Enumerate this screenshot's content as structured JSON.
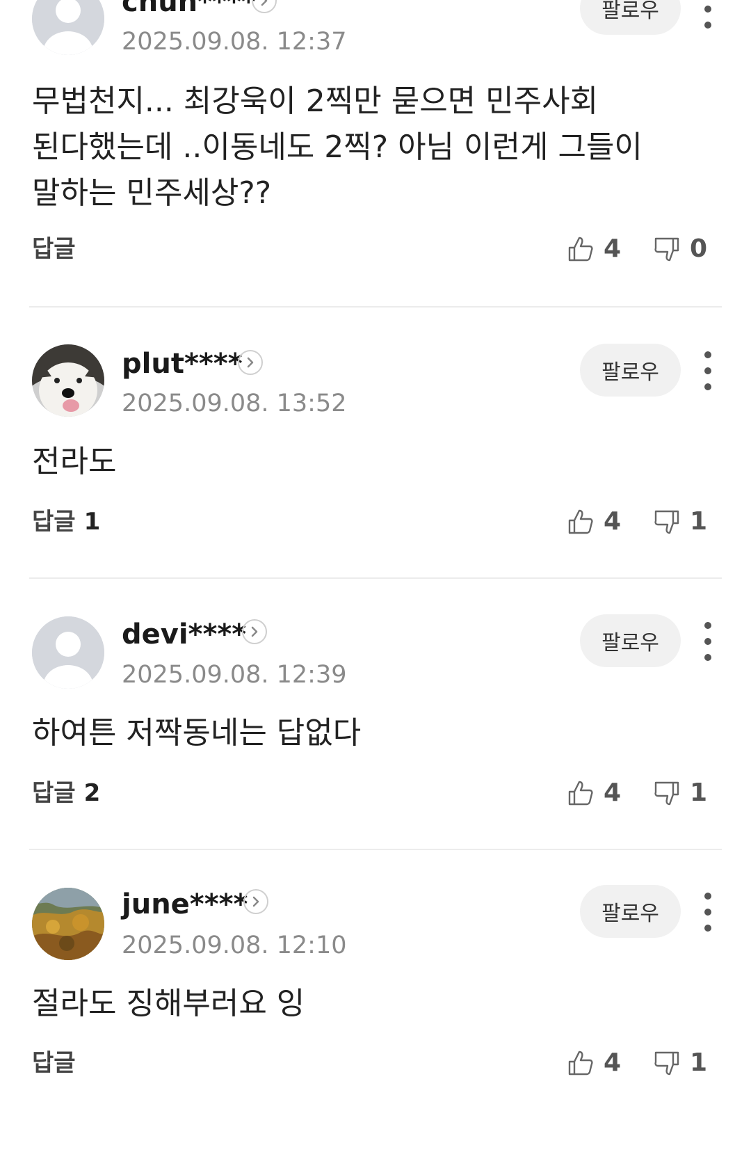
{
  "labels": {
    "follow": "팔로우",
    "reply": "답글"
  },
  "comments": [
    {
      "user": "chun****",
      "time": "2025.09.08. 12:37",
      "avatar": "default-avatar",
      "text": "무법천지... 최강욱이 2찍만 묻으면 민주사회 된다했는데 ..이동네도 2찍? 아님 이런게 그들이 말하는 민주세상??",
      "reply_count": "",
      "likes": "4",
      "dislikes": "0"
    },
    {
      "user": "plut****",
      "time": "2025.09.08. 13:52",
      "avatar": "husky-dog-photo",
      "text": "전라도",
      "reply_count": "1",
      "likes": "4",
      "dislikes": "1"
    },
    {
      "user": "devi****",
      "time": "2025.09.08. 12:39",
      "avatar": "default-avatar",
      "text": "하여튼 저짝동네는 답없다",
      "reply_count": "2",
      "likes": "4",
      "dislikes": "1"
    },
    {
      "user": "june****",
      "time": "2025.09.08. 12:10",
      "avatar": "autumn-forest-photo",
      "text": "절라도 징해부러요 잉",
      "reply_count": "",
      "likes": "4",
      "dislikes": "1"
    }
  ]
}
